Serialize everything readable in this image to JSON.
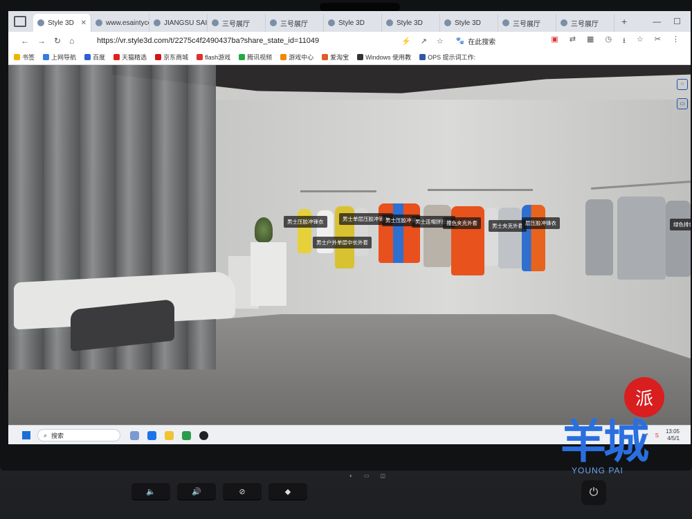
{
  "browser": {
    "tabs": [
      {
        "label": "Style 3D",
        "active": true
      },
      {
        "label": "www.esaintycorp",
        "active": false
      },
      {
        "label": "JIANGSU SAINT",
        "active": false
      },
      {
        "label": "三号展厅",
        "active": false
      },
      {
        "label": "三号展厅",
        "active": false
      },
      {
        "label": "Style 3D",
        "active": false
      },
      {
        "label": "Style 3D",
        "active": false
      },
      {
        "label": "Style 3D",
        "active": false
      },
      {
        "label": "三号展厅",
        "active": false
      },
      {
        "label": "三号展厅",
        "active": false
      }
    ],
    "url": "https://vr.style3d.com/t/2275c4f2490437ba?share_state_id=11049",
    "search_label": "在此搜索",
    "bookmarks": [
      "书签",
      "上网导航",
      "百度",
      "天猫精选",
      "京东商城",
      "flash游戏",
      "腾讯视频",
      "游戏中心",
      "爱淘宝",
      "Windows 使用教",
      "OPS 提示词工作:"
    ]
  },
  "showroom": {
    "labels": [
      "男士压胶冲锋衣",
      "男士单层压胶冲锋衣",
      "男士户外单层中长外套",
      "男士压胶冲锋",
      "男士连帽拼接是",
      "撞色夹克外套",
      "男士夹克外套",
      "层压胶冲锋衣",
      "绿色排色"
    ]
  },
  "taskbar": {
    "search_placeholder": "搜索",
    "time": "13:05",
    "date": "4/5/1"
  },
  "watermark": {
    "seal_char": "派",
    "big_text": "羊城",
    "small_text": "YOUNG PAI"
  },
  "colors": {
    "accent": "#1e4fa8",
    "watermark_blue": "#2a6fe0",
    "seal_red": "#d81e1e"
  }
}
